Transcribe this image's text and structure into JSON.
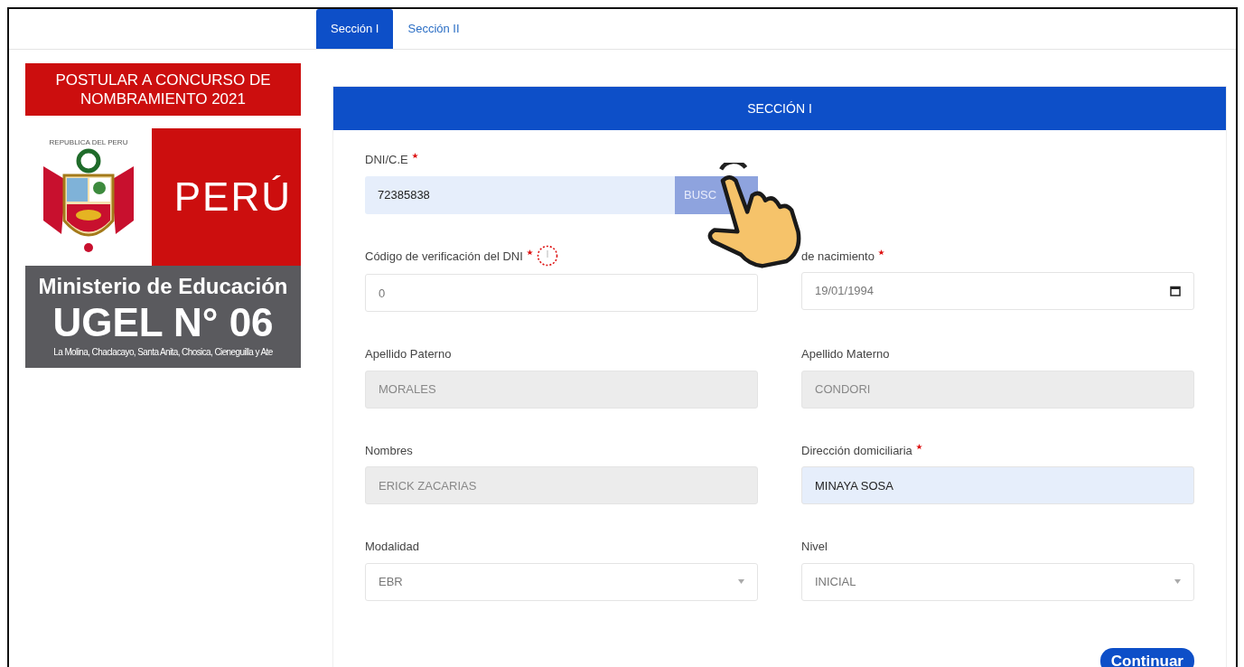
{
  "tabs": [
    {
      "label": "Sección I",
      "selected": true
    },
    {
      "label": "Sección II",
      "selected": false
    }
  ],
  "sidebar": {
    "banner": "POSTULAR A CONCURSO DE NOMBRAMIENTO 2021",
    "emblem_caption": "REPUBLICA DEL PERU",
    "country": "PERÚ",
    "ministry": "Ministerio de Educación",
    "office": "UGEL N° 06",
    "districts": "La Molina, Chaclacayo, Santa Anita, Chosica, Cieneguilla y Ate"
  },
  "section": {
    "title": "SECCIÓN I"
  },
  "fields": [
    {
      "kind": "search",
      "label": "DNI/C.E",
      "required": true,
      "value": "72385838",
      "button": "BUSC",
      "readonly": false,
      "autofilled": true,
      "hint_icon": false
    },
    {
      "kind": "spacer"
    },
    {
      "kind": "text",
      "label": "Código de verificación del DNI",
      "required": true,
      "value": "0",
      "readonly": false,
      "autofilled": false,
      "hint_icon": true
    },
    {
      "kind": "date",
      "label": "de nacimiento",
      "required": true,
      "value": "19/01/1994",
      "readonly": false,
      "autofilled": false,
      "hint_icon": false
    },
    {
      "kind": "text",
      "label": "Apellido Paterno",
      "required": false,
      "value": "MORALES",
      "readonly": true,
      "autofilled": false,
      "hint_icon": false
    },
    {
      "kind": "text",
      "label": "Apellido Materno",
      "required": false,
      "value": "CONDORI",
      "readonly": true,
      "autofilled": false,
      "hint_icon": false
    },
    {
      "kind": "text",
      "label": "Nombres",
      "required": false,
      "value": "ERICK ZACARIAS",
      "readonly": true,
      "autofilled": false,
      "hint_icon": false
    },
    {
      "kind": "text",
      "label": "Dirección domiciliaria",
      "required": true,
      "value": "MINAYA SOSA",
      "readonly": false,
      "autofilled": true,
      "hint_icon": false
    },
    {
      "kind": "select",
      "label": "Modalidad",
      "required": false,
      "value": "EBR",
      "readonly": false,
      "autofilled": false,
      "hint_icon": false
    },
    {
      "kind": "select",
      "label": "Nivel",
      "required": false,
      "value": "INICIAL",
      "readonly": false,
      "autofilled": false,
      "hint_icon": false
    }
  ],
  "submit": "Continuar"
}
